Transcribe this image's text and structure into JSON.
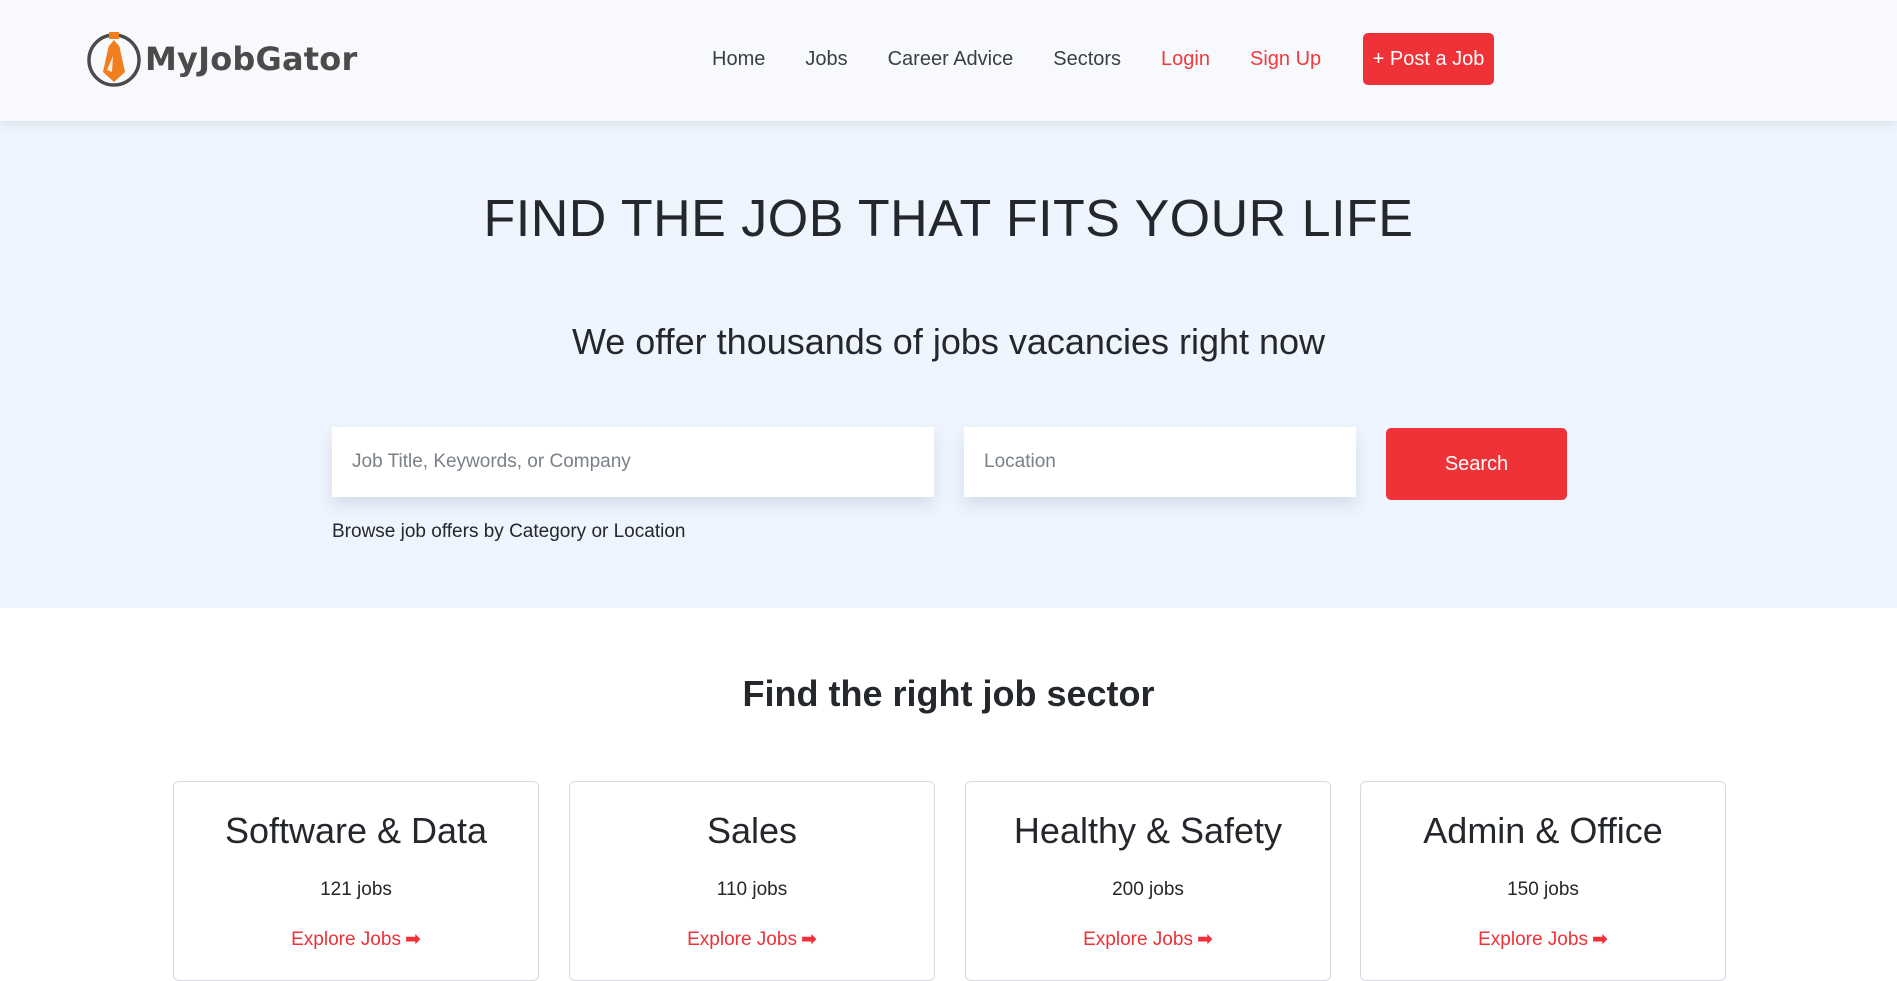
{
  "brand": {
    "name": "MyJobGator"
  },
  "nav": {
    "items": [
      {
        "label": "Home"
      },
      {
        "label": "Jobs"
      },
      {
        "label": "Career Advice"
      },
      {
        "label": "Sectors"
      },
      {
        "label": "Login"
      },
      {
        "label": "Sign Up"
      }
    ],
    "post_job_label": "+ Post a Job"
  },
  "hero": {
    "title": "FIND THE JOB THAT FITS YOUR LIFE",
    "subtitle": "We offer thousands of jobs vacancies right now",
    "keyword_placeholder": "Job Title, Keywords, or Company",
    "location_placeholder": "Location",
    "search_label": "Search",
    "browse_text": "Browse job offers by Category or Location"
  },
  "sectors": {
    "title": "Find the right job sector",
    "cards": [
      {
        "name": "Software & Data",
        "count": "121 jobs",
        "link": "Explore Jobs"
      },
      {
        "name": "Sales",
        "count": "110 jobs",
        "link": "Explore Jobs"
      },
      {
        "name": "Healthy & Safety",
        "count": "200 jobs",
        "link": "Explore Jobs"
      },
      {
        "name": "Admin & Office",
        "count": "150 jobs",
        "link": "Explore Jobs"
      }
    ]
  },
  "colors": {
    "accent": "#ef3138",
    "hero_bg": "#eff5fe",
    "nav_bg": "#f7f9fc",
    "logo_orange": "#f07d1e"
  },
  "icons": {
    "logo": "tie-logo-icon",
    "explore": "arrow-right-icon"
  }
}
